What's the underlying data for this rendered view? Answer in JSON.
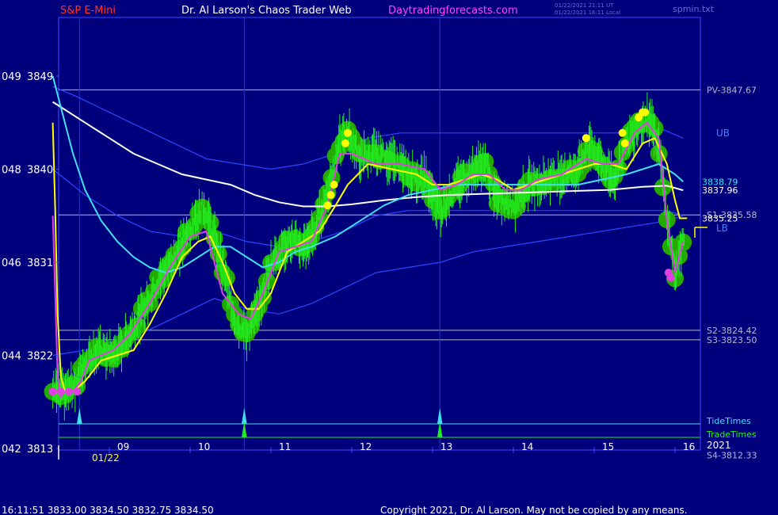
{
  "header": {
    "symbol": "S&P E-Mini",
    "author": "Dr. Al Larson's Chaos Trader Web",
    "site": "Daytradingforecasts.com",
    "stamp_line1": "01/22/2021 21:11 UT",
    "stamp_line2": "01/22/2021 16:11 Local",
    "file": "spmin.txt"
  },
  "footer": {
    "quote": "16:11:51  3833.00 3834.50 3832.75 3834.50",
    "copyright": "Copyright 2021, Dr. Al Larson. May not be copied by any means."
  },
  "colors": {
    "background": "#00007c",
    "frame": "#3a4cff",
    "price_bars": "#22ee22",
    "halo": "#22aa00",
    "magenta_ma": "#e040e0",
    "yellow_ma": "#ffff00",
    "cyan_ma": "#40e0f0",
    "white_ma": "#ffffff",
    "bands": "#2848ff",
    "pivot_lines": "#b8b8d0",
    "tide_times": "#40e0f0",
    "trade_times": "#22ee22"
  },
  "chart_data": {
    "type": "line",
    "x_axis": {
      "date_label": "01/22",
      "ticks": [
        "09",
        "10",
        "11",
        "12",
        "13",
        "14",
        "15",
        "16"
      ],
      "range_hours": [
        8.3,
        16.2
      ]
    },
    "y_axis": {
      "ticks": [
        {
          "left": "042",
          "price": "3813",
          "value": 3813
        },
        {
          "left": "044",
          "price": "3822",
          "value": 3822
        },
        {
          "left": "046",
          "price": "3831",
          "value": 3831
        },
        {
          "left": "048",
          "price": "3840",
          "value": 3840
        },
        {
          "left": "049",
          "price": "3849",
          "value": 3849
        }
      ],
      "range": [
        3813,
        3850
      ]
    },
    "levels": [
      {
        "label": "PV-3847.67",
        "value": 3847.67
      },
      {
        "label": "S1-3835.58",
        "value": 3835.58
      },
      {
        "label": "S2-3824.42",
        "value": 3824.42
      },
      {
        "label": "S3-3823.50",
        "value": 3823.5
      },
      {
        "label": "S4-3812.33",
        "value": 3812.33
      }
    ],
    "value_labels": [
      {
        "label": "3838.79",
        "value": 3838.79,
        "series": "cyan"
      },
      {
        "label": "3837.96",
        "value": 3837.96,
        "series": "white"
      },
      {
        "label": "3835.25",
        "value": 3835.25,
        "series": "yellow"
      }
    ],
    "band_labels": {
      "upper": "UB",
      "lower": "LB"
    },
    "time_rows": [
      {
        "label": "TideTimes",
        "color_key": "tide_times",
        "spikes_hours": [
          8.63,
          10.67,
          13.09
        ]
      },
      {
        "label": "TradeTimes",
        "color_key": "trade_times",
        "spikes_hours": [
          10.67,
          13.09
        ]
      }
    ],
    "year_label": "2021",
    "series": [
      {
        "key": "price",
        "color_key": "price_bars",
        "x": [
          8.3,
          8.45,
          8.6,
          8.72,
          8.85,
          9.05,
          9.2,
          9.4,
          9.6,
          9.8,
          10.0,
          10.15,
          10.3,
          10.45,
          10.55,
          10.7,
          10.85,
          11.0,
          11.2,
          11.4,
          11.55,
          11.7,
          11.85,
          11.95,
          12.1,
          12.3,
          12.5,
          12.7,
          12.9,
          13.1,
          13.3,
          13.5,
          13.65,
          13.8,
          14.0,
          14.2,
          14.4,
          14.6,
          14.8,
          14.95,
          15.1,
          15.25,
          15.4,
          15.55,
          15.7,
          15.8,
          15.9,
          16.0,
          16.1
        ],
        "y": [
          3818.5,
          3818.5,
          3819.5,
          3821.5,
          3822.5,
          3822.0,
          3823.5,
          3826,
          3829,
          3831.5,
          3834,
          3836.5,
          3833.5,
          3829,
          3825.5,
          3824.0,
          3826.5,
          3831,
          3833,
          3832.5,
          3834,
          3838,
          3842.5,
          3843.5,
          3841,
          3841.5,
          3841,
          3839.5,
          3839,
          3836.0,
          3838.5,
          3840,
          3840.5,
          3837,
          3836.5,
          3838.5,
          3839,
          3839.5,
          3840,
          3842.5,
          3840.5,
          3839,
          3842.5,
          3844.5,
          3845,
          3842,
          3835.5,
          3830,
          3833.0
        ]
      },
      {
        "key": "magenta",
        "color_key": "magenta_ma",
        "x": [
          8.3,
          8.33,
          8.36,
          8.4,
          8.45,
          8.55,
          8.65,
          8.75,
          8.9,
          9.05,
          9.25,
          9.5,
          9.75,
          10.0,
          10.2,
          10.4,
          10.6,
          10.75,
          10.9,
          11.1,
          11.3,
          11.5,
          11.7,
          11.85,
          12.0,
          12.3,
          12.6,
          12.9,
          13.1,
          13.3,
          13.5,
          13.7,
          13.9,
          14.1,
          14.3,
          14.6,
          14.9,
          15.1,
          15.3,
          15.5,
          15.65,
          15.8,
          15.9,
          16.0,
          16.1
        ],
        "y": [
          3835.5,
          3828,
          3820,
          3818,
          3818.5,
          3818.5,
          3819.5,
          3821.5,
          3822,
          3822.5,
          3824,
          3827,
          3830.5,
          3833.5,
          3834,
          3828,
          3826,
          3825.5,
          3828,
          3832,
          3832.5,
          3833,
          3836.5,
          3841.5,
          3841.5,
          3840.5,
          3840.5,
          3840,
          3838,
          3838.5,
          3839.5,
          3839.5,
          3838,
          3838,
          3839,
          3839.5,
          3841,
          3840.5,
          3840.5,
          3843.5,
          3844.5,
          3843,
          3835,
          3830,
          3833
        ]
      },
      {
        "key": "yellow",
        "color_key": "yellow_ma",
        "x": [
          8.3,
          8.33,
          8.36,
          8.4,
          8.45,
          8.55,
          8.7,
          8.9,
          9.1,
          9.3,
          9.5,
          9.7,
          9.9,
          10.1,
          10.25,
          10.4,
          10.55,
          10.7,
          10.85,
          11.0,
          11.2,
          11.4,
          11.6,
          11.8,
          11.95,
          12.2,
          12.5,
          12.8,
          13.0,
          13.2,
          13.4,
          13.6,
          13.8,
          14.0,
          14.2,
          14.4,
          14.6,
          14.8,
          15.0,
          15.2,
          15.4,
          15.6,
          15.75,
          15.9,
          16.0,
          16.06,
          16.15
        ],
        "y": [
          3844.5,
          3836,
          3826,
          3820,
          3818.5,
          3818.5,
          3819.5,
          3821.5,
          3822,
          3822.5,
          3825,
          3828,
          3831.5,
          3833,
          3833.5,
          3831,
          3828,
          3826.5,
          3826.5,
          3828,
          3832,
          3833,
          3834,
          3836.5,
          3838.5,
          3840.5,
          3840,
          3839.5,
          3838.5,
          3838.5,
          3839,
          3839.5,
          3839,
          3838,
          3838.5,
          3839,
          3839.5,
          3840,
          3840.5,
          3840.5,
          3840,
          3842.5,
          3843,
          3840.5,
          3837,
          3835.25,
          3835.25
        ]
      },
      {
        "key": "cyan",
        "color_key": "cyan_ma",
        "x": [
          8.3,
          8.4,
          8.55,
          8.7,
          8.9,
          9.1,
          9.3,
          9.5,
          9.7,
          9.9,
          10.1,
          10.3,
          10.5,
          10.7,
          10.9,
          11.1,
          11.3,
          11.5,
          11.8,
          12.1,
          12.4,
          12.7,
          13.0,
          13.3,
          13.6,
          13.9,
          14.2,
          14.5,
          14.8,
          15.1,
          15.4,
          15.6,
          15.8,
          16.0,
          16.1
        ],
        "y": [
          3849,
          3846,
          3841.5,
          3838,
          3835,
          3833,
          3831.5,
          3830.5,
          3830,
          3830.5,
          3831.5,
          3832.5,
          3832.5,
          3831.5,
          3830.5,
          3831,
          3832,
          3832.5,
          3833.5,
          3835,
          3836.5,
          3837.5,
          3838,
          3838.5,
          3838.5,
          3838.5,
          3838.5,
          3838.5,
          3838.5,
          3839,
          3839.5,
          3840,
          3840.5,
          3839.5,
          3838.79
        ]
      },
      {
        "key": "white",
        "color_key": "white_ma",
        "x": [
          8.3,
          8.5,
          8.7,
          9.0,
          9.3,
          9.6,
          9.9,
          10.2,
          10.5,
          10.8,
          11.1,
          11.4,
          11.7,
          12.0,
          12.4,
          12.8,
          13.2,
          13.6,
          14.0,
          14.4,
          14.8,
          15.2,
          15.6,
          15.9,
          16.1
        ],
        "y": [
          3846.5,
          3845.5,
          3844.5,
          3843,
          3841.5,
          3840.5,
          3839.5,
          3839,
          3838.5,
          3837.5,
          3836.8,
          3836.4,
          3836.4,
          3836.6,
          3837,
          3837.3,
          3837.5,
          3837.6,
          3837.7,
          3837.8,
          3837.9,
          3838,
          3838.3,
          3838.4,
          3837.96
        ]
      },
      {
        "key": "upper_band",
        "color_key": "bands",
        "x": [
          8.3,
          8.6,
          9.0,
          9.4,
          9.8,
          10.2,
          10.6,
          11.0,
          11.4,
          11.8,
          12.2,
          12.6,
          13.0,
          13.4,
          13.8,
          14.2,
          14.6,
          15.0,
          15.4,
          15.8,
          16.1
        ],
        "y": [
          3848,
          3847,
          3845.5,
          3844,
          3842.5,
          3841,
          3840.5,
          3840,
          3840.5,
          3841.5,
          3843,
          3843.5,
          3843.5,
          3843.5,
          3843.5,
          3843.5,
          3843.5,
          3843.5,
          3843.5,
          3844,
          3843
        ]
      },
      {
        "key": "mid_band",
        "color_key": "bands",
        "x": [
          8.3,
          8.7,
          9.1,
          9.5,
          9.9,
          10.3,
          10.7,
          11.1,
          11.5,
          11.9,
          12.3,
          12.7,
          13.1,
          13.5,
          13.9,
          14.3,
          14.7,
          15.1,
          15.5,
          15.9,
          16.1
        ],
        "y": [
          3840,
          3837.5,
          3835.5,
          3834,
          3833.5,
          3834,
          3833,
          3832.5,
          3833,
          3834,
          3835.5,
          3836,
          3836,
          3836,
          3836,
          3836,
          3836,
          3836,
          3836,
          3836,
          3835.5
        ]
      },
      {
        "key": "lower_band",
        "color_key": "bands",
        "x": [
          8.3,
          8.7,
          9.1,
          9.5,
          9.9,
          10.3,
          10.7,
          11.1,
          11.5,
          11.9,
          12.3,
          12.7,
          13.1,
          13.5,
          13.9,
          14.3,
          14.7,
          15.1,
          15.5,
          15.9,
          16.1
        ],
        "y": [
          3822,
          3822.5,
          3823.5,
          3824.5,
          3826,
          3827.5,
          3826.5,
          3826,
          3827,
          3828.5,
          3830,
          3830.5,
          3831,
          3832,
          3832.5,
          3833,
          3833.5,
          3834,
          3834.5,
          3835,
          3835.5
        ]
      }
    ],
    "event_dots": {
      "yellow_hours": [
        11.7,
        11.74,
        11.78,
        11.92,
        11.95,
        14.9,
        15.35,
        15.38,
        15.55,
        15.6,
        15.63
      ],
      "yellow_values": [
        3836.5,
        3837.5,
        3838.5,
        3842.5,
        3843.5,
        3843,
        3843.5,
        3842.5,
        3845,
        3845.5,
        3845.5
      ],
      "magenta_hours": [
        8.3,
        8.4,
        8.5,
        8.6,
        15.92,
        15.95
      ],
      "magenta_values": [
        3818.5,
        3818.5,
        3818.5,
        3818.5,
        3830,
        3829.5
      ]
    }
  }
}
